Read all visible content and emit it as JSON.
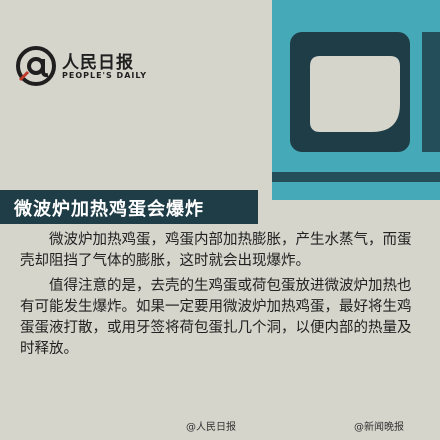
{
  "brand": {
    "name_cn": "人民日报",
    "name_en": "PEOPLE'S DAILY"
  },
  "headline": "微波炉加热鸡蛋会爆炸",
  "paragraphs": [
    "微波炉加热鸡蛋，鸡蛋内部加热膨胀，产生水蒸气，而蛋壳却阻挡了气体的膨胀，这时就会出现爆炸。",
    "值得注意的是，去壳的生鸡蛋或荷包蛋放进微波炉加热也有可能发生爆炸。如果一定要用微波炉加热鸡蛋，最好将生鸡蛋蛋液打散，或用牙签将荷包蛋扎几个洞，以便内部的热量及时释放。"
  ],
  "footer": {
    "source": "@人民日报",
    "watermark": "@新闻晚报"
  },
  "colors": {
    "background": "#d5d5cc",
    "banner": "#1e3d47",
    "microwave_frame": "#46a9b8",
    "microwave_dark": "#234e5a"
  }
}
